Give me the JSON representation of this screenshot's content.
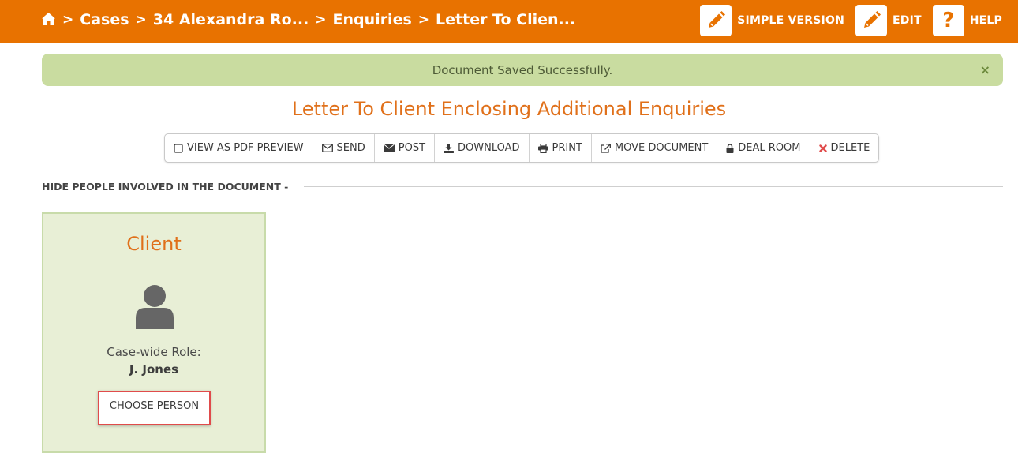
{
  "breadcrumb": {
    "items": [
      "Cases",
      "34 Alexandra Ro...",
      "Enquiries",
      "Letter To Clien..."
    ],
    "separator": ">"
  },
  "top_actions": {
    "simple_version": "SIMPLE VERSION",
    "edit": "EDIT",
    "help": "HELP",
    "help_glyph": "?"
  },
  "alert": {
    "message": "Document Saved Successfully.",
    "close_glyph": "×"
  },
  "document": {
    "title": "Letter To Client Enclosing Additional Enquiries"
  },
  "toolbar": {
    "view_pdf": "VIEW AS PDF PREVIEW",
    "send": "SEND",
    "post": "POST",
    "download": "DOWNLOAD",
    "print": "PRINT",
    "move_document": "MOVE DOCUMENT",
    "deal_room": "DEAL ROOM",
    "delete": "DELETE"
  },
  "people_section": {
    "toggle_label": "HIDE PEOPLE INVOLVED IN THE DOCUMENT -"
  },
  "client_card": {
    "role_title": "Client",
    "role_label": "Case-wide Role:",
    "person_name": "J. Jones",
    "choose_person": "CHOOSE PERSON"
  },
  "colors": {
    "brand_orange": "#e87200",
    "title_orange": "#e0701a",
    "alert_green": "#c9dca0",
    "card_green": "#e8efd6",
    "delete_red": "#e04b4b"
  },
  "icons": {
    "home": "home-icon",
    "pencil": "pencil-icon",
    "question": "question-icon",
    "square": "checkbox-square-icon",
    "envelope_open": "envelope-outline-icon",
    "envelope": "envelope-icon",
    "download": "download-icon",
    "print": "printer-icon",
    "external": "external-link-icon",
    "lock": "lock-icon",
    "times": "times-icon",
    "user": "user-avatar-icon"
  }
}
